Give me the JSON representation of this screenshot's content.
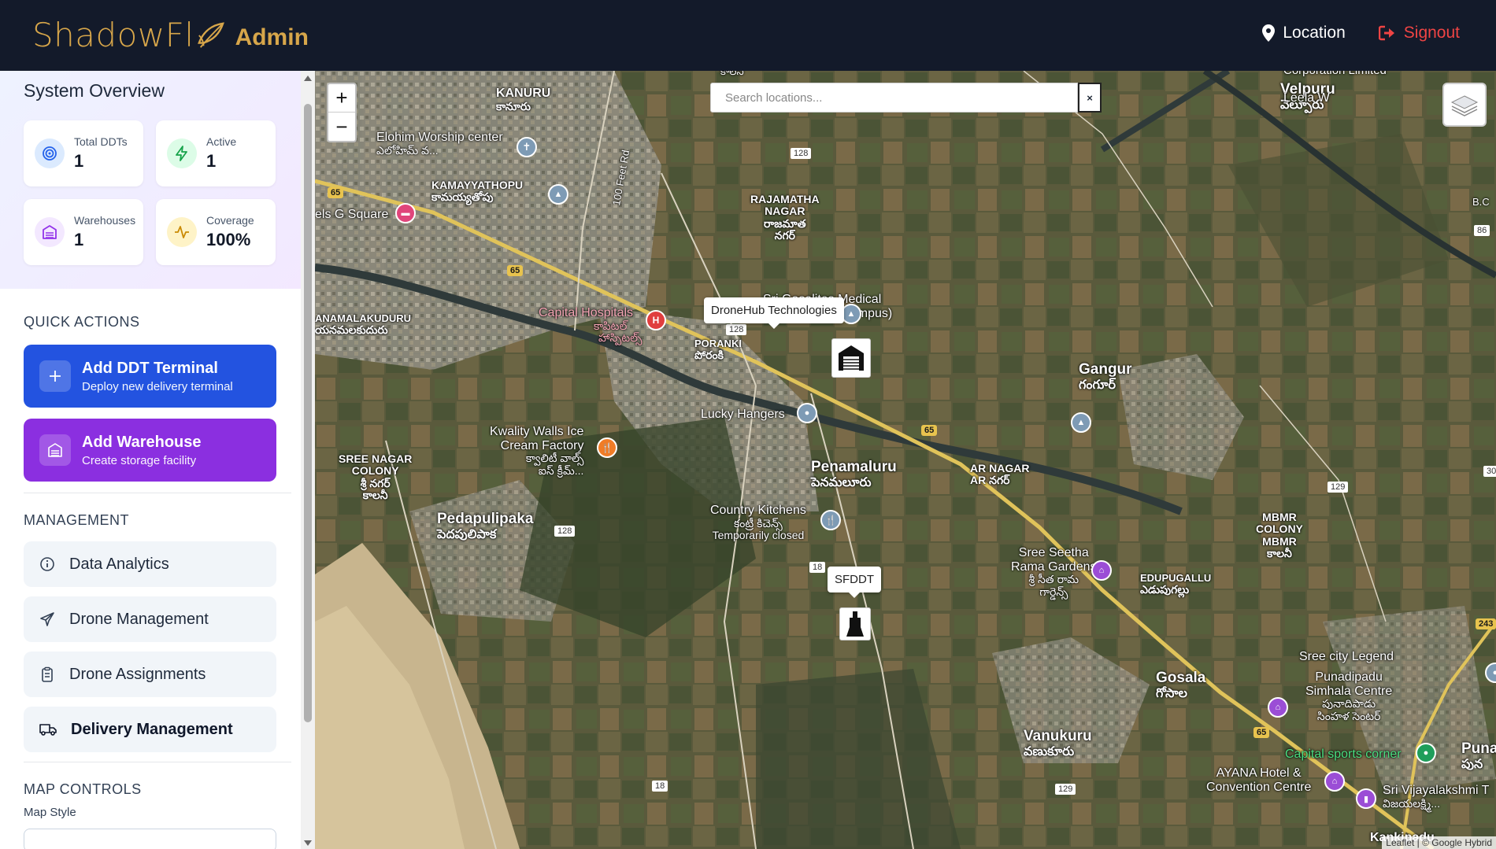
{
  "header": {
    "brand_name": "ShadowFl",
    "brand_suffix": "Admin",
    "location_label": "Location",
    "signout_label": "Signout"
  },
  "overview": {
    "title": "System Overview",
    "stats": [
      {
        "label": "Total DDTs",
        "value": "1",
        "icon": "target-icon",
        "color": "#2563eb",
        "bg": "#dbeafe"
      },
      {
        "label": "Active",
        "value": "1",
        "icon": "lightning-icon",
        "color": "#16a34a",
        "bg": "#dcfce7"
      },
      {
        "label": "Warehouses",
        "value": "1",
        "icon": "warehouse-icon",
        "color": "#9333ea",
        "bg": "#f3e8ff"
      },
      {
        "label": "Coverage",
        "value": "100%",
        "icon": "pulse-icon",
        "color": "#ca8a04",
        "bg": "#fef3c7"
      }
    ]
  },
  "quick_actions": {
    "title": "QUICK ACTIONS",
    "add_ddt": {
      "title": "Add DDT Terminal",
      "subtitle": "Deploy new delivery terminal"
    },
    "add_warehouse": {
      "title": "Add Warehouse",
      "subtitle": "Create storage facility"
    }
  },
  "management": {
    "title": "MANAGEMENT",
    "items": [
      {
        "label": "Data Analytics",
        "icon": "info-icon"
      },
      {
        "label": "Drone Management",
        "icon": "plane-icon"
      },
      {
        "label": "Drone Assignments",
        "icon": "clipboard-icon"
      },
      {
        "label": "Delivery Management",
        "icon": "truck-icon"
      }
    ]
  },
  "map_controls": {
    "title": "MAP CONTROLS",
    "style_label": "Map Style"
  },
  "map": {
    "search_placeholder": "Search locations...",
    "search_close": "×",
    "zoom_in": "+",
    "zoom_out": "−",
    "markers": [
      {
        "label": "DroneHub Technologies",
        "type": "warehouse"
      },
      {
        "label": "SFDDT",
        "type": "ddt"
      }
    ],
    "places": {
      "kanuru": "KANURU",
      "kanuru_te": "కానూరు",
      "elohim": "Elohim Worship center",
      "elohim_te": "ఎలోహిమ్ వ...",
      "kamayya": "KAMAYYATHOPU",
      "kamayya_te": "కామయ్యతోపు",
      "els_g": "els G Square",
      "rajamatha": "RAJAMATHA",
      "rajamatha2": "NAGAR",
      "rajamatha_te": "రాజమాత",
      "rajamatha_te2": "నగర్",
      "anamalakuduru": "ANAMALAKUDURU",
      "anamalakuduru_te": "యనమలకుదురు",
      "capital": "Capital Hospitals",
      "capital_te": "కాపిటల్",
      "capital_te2": "హాస్పిటల్స్",
      "poranki": "PORANKI",
      "poranki_te": "పోరంకి",
      "gosalites": "Sri Gosalites Medical",
      "gosalites2": "Academy (girls' Campus)",
      "lucky": "Lucky Hangers",
      "kwality": "Kwality Walls Ice",
      "kwality2": "Cream Factory",
      "kwality_te": "క్వాలిటీ వాల్స్",
      "kwality_te2": "ఐస్ క్రీమ్...",
      "sree_nagar": "SREE NAGAR",
      "sree_nagar2": "COLONY",
      "sree_nagar_te": "శ్రీ నగర్",
      "sree_nagar_te2": "కాలనీ",
      "penamaluru": "Penamaluru",
      "penamaluru_te": "పెనమలూరు",
      "pedapulipaka": "Pedapulipaka",
      "pedapulipaka_te": "పెదపులిపాక",
      "country": "Country Kitchens",
      "country_te": "కంట్రీ కిచెన్స్",
      "country_closed": "Temporarily closed",
      "gangur": "Gangur",
      "gangur_te": "గంగూర్",
      "ar_nagar": "AR NAGAR",
      "ar_nagar_te": "AR నగర్",
      "velpuru": "Velpuru",
      "velpuru_te": "వెల్పూరు",
      "leela": "Leela W",
      "corp": "Corporation Limited",
      "sree_seetha": "Sree Seetha",
      "sree_seetha2": "Rama Gardens",
      "sree_seetha_te": "శ్రీ సీత రామ",
      "sree_seetha_te2": "గార్డెన్స్",
      "edupugallu": "EDUPUGALLU",
      "edupugallu_te": "ఎడుపుగల్లు",
      "mbmr": "MBMR",
      "mbmr2": "COLONY",
      "mbmr3": "MBMR",
      "mbmr_te": "కాలనీ",
      "gosala": "Gosala",
      "gosala_te": "గోసాల",
      "vanukuru": "Vanukuru",
      "vanukuru_te": "వణుకూరు",
      "sree_city": "Sree city Legend",
      "punadipadu": "Punadipadu",
      "simhala": "Simhala Centre",
      "simhala_te": "పునాదిపాడు",
      "simhala_te2": "సింహళ సెంటర్",
      "capital_sports": "Capital sports corner",
      "ayana": "AYANA Hotel &",
      "ayana2": "Convention Centre",
      "vijayalakshmi": "Sri Vijayalakshmi T",
      "vijayalakshmi_te": "విజయలక్ష్మి...",
      "puna": "Puna",
      "puna_te": "పున",
      "kankipadu": "Kankipadu",
      "bc": "B.C",
      "road_100": "100 Feet Rd",
      "kalani": "కాలనీ"
    },
    "road_shields": {
      "r65": "65",
      "r128": "128",
      "r18": "18",
      "r129": "129",
      "r86": "86",
      "r30": "30",
      "r243": "243"
    },
    "attribution": "Leaflet | © Google Hybrid"
  },
  "colors": {
    "header_bg": "#131a2a",
    "brand_gold": "#d7a64a",
    "signout_red": "#ef4444",
    "action_blue": "#2353e0",
    "action_purple": "#8b2fe0"
  }
}
